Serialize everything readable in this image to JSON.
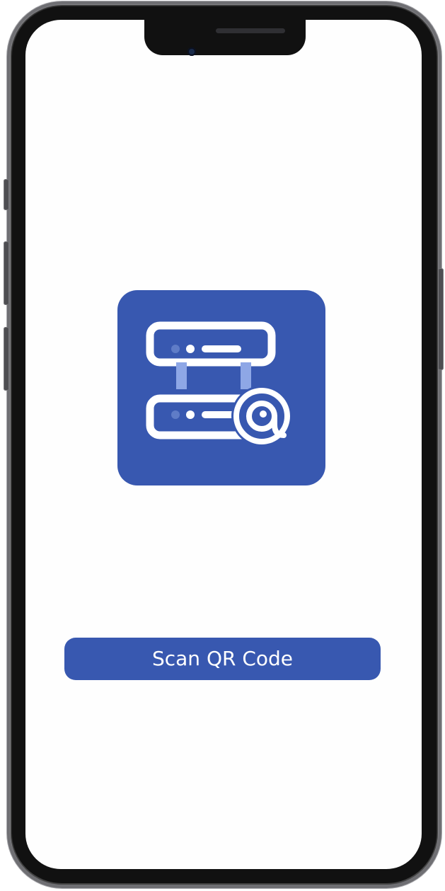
{
  "app": {
    "icon": "mail-server-icon",
    "accent_color": "#3858b0"
  },
  "actions": {
    "scan_button_label": "Scan QR Code"
  },
  "device": {
    "frame": "smartphone-frame",
    "notch_icon": "front-camera-icon"
  }
}
